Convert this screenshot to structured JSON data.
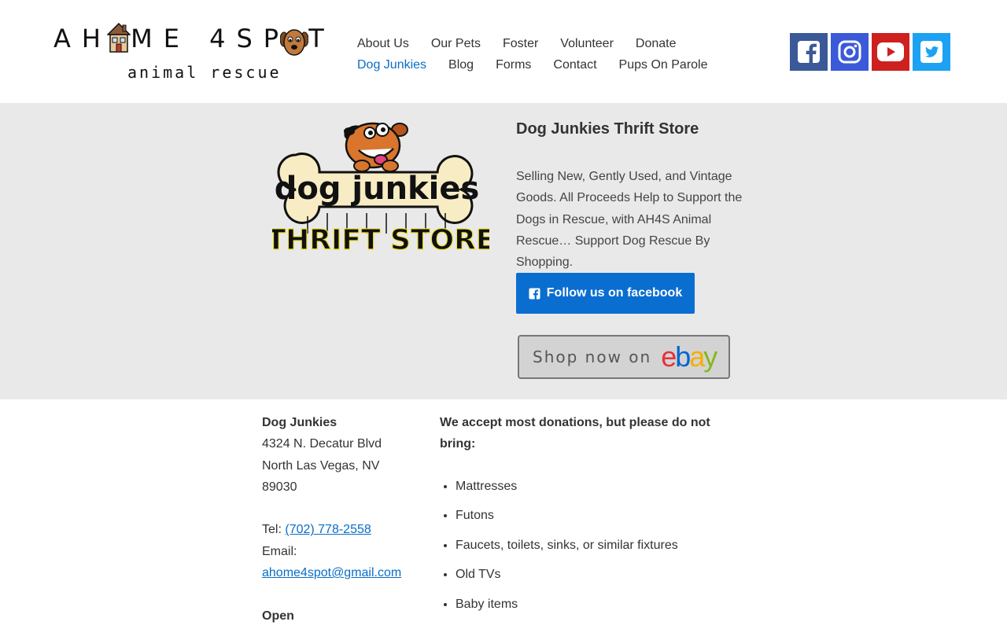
{
  "logo": {
    "line1": "AH  ME 4SP  T",
    "line2": "animal rescue"
  },
  "nav": {
    "row1": [
      "About Us",
      "Our Pets",
      "Foster",
      "Volunteer",
      "Donate"
    ],
    "row2": [
      "Dog Junkies",
      "Blog",
      "Forms",
      "Contact",
      "Pups On Parole"
    ],
    "active": "Dog Junkies"
  },
  "social": {
    "icons": [
      "facebook-icon",
      "instagram-icon",
      "youtube-icon",
      "twitter-icon"
    ],
    "colors": {
      "facebook": "#3b5998",
      "instagram": "#3b5ad9",
      "youtube": "#cd201f",
      "twitter": "#1da1f2"
    }
  },
  "hero": {
    "logo_text_top": "dog junkies",
    "logo_text_bottom": "THRIFT STORE",
    "title": "Dog Junkies Thrift Store",
    "description": "Selling New, Gently Used, and Vintage Goods. All Proceeds Help to Support the Dogs in Rescue, with AH4S Animal Rescue… Support Dog Rescue By Shopping.",
    "facebook_button": "Follow us on facebook",
    "ebay_button_text": "Shop now on",
    "ebay_logo": "ebay"
  },
  "address": {
    "name": "Dog Junkies",
    "street": "4324 N. Decatur Blvd",
    "city": "North Las Vegas, NV",
    "zip": "89030",
    "tel_label": "Tel:",
    "tel": "(702) 778-2558",
    "email_label": "Email:",
    "email": "ahome4spot@gmail.com",
    "hours_label": "Open"
  },
  "donations": {
    "heading": "We accept most donations, but please do not bring:",
    "items": [
      "Mattresses",
      "Futons",
      "Faucets, toilets, sinks, or similar fixtures",
      "Old TVs",
      "Baby items"
    ]
  },
  "accent": "#0a6ec8"
}
